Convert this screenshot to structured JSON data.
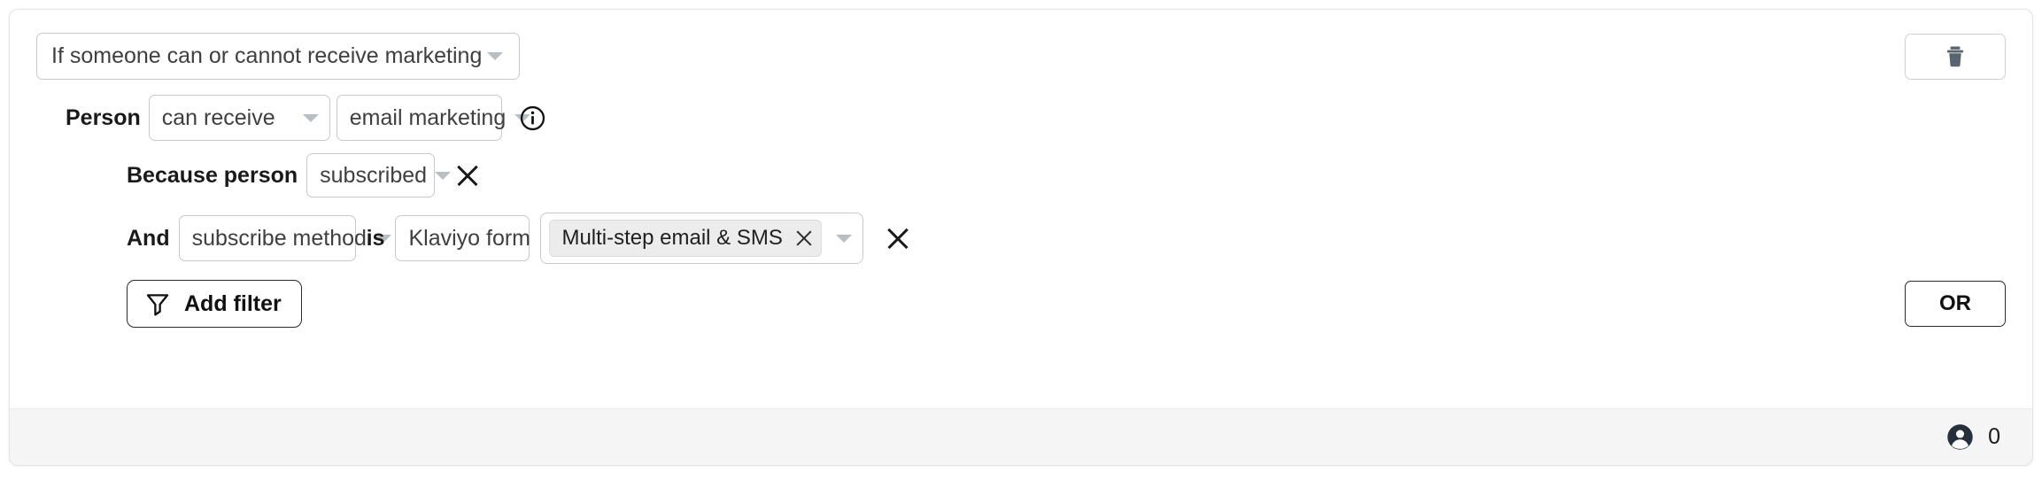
{
  "card": {
    "condition_select": {
      "value": "If someone can or cannot receive marketing",
      "caret_icon": "chevron-down-icon"
    },
    "delete_button": {
      "icon": "trash-icon",
      "label": ""
    },
    "person_row": {
      "label": "Person",
      "operator_select": {
        "value": "can receive",
        "caret_icon": "chevron-down-icon"
      },
      "channel_select": {
        "value": "email marketing",
        "caret_icon": "chevron-down-icon"
      },
      "info_icon": "info-circle-icon"
    },
    "because_row": {
      "label": "Because person",
      "reason_select": {
        "value": "subscribed",
        "caret_icon": "chevron-down-icon"
      },
      "remove_icon": "close-x-icon"
    },
    "and_row": {
      "label": "And",
      "attribute_select": {
        "value": "subscribe method",
        "caret_icon": "chevron-down-icon"
      },
      "comparator_label": "is",
      "source_select": {
        "value": "Klaviyo form",
        "caret_icon": "chevron-down-icon"
      },
      "value_multiselect": {
        "chips": [
          {
            "label": "Multi-step email & SMS",
            "remove_icon": "close-x-icon"
          }
        ],
        "caret_icon": "chevron-down-icon"
      },
      "remove_icon": "close-x-icon"
    },
    "bottom_row": {
      "add_filter_button": {
        "label": "Add filter",
        "icon": "funnel-icon"
      },
      "or_button": {
        "label": "OR"
      }
    },
    "footer": {
      "count_icon": "person-circle-icon",
      "count": "0"
    }
  },
  "colors": {
    "card_border": "#e3e3e3",
    "footer_bg": "#f5f5f5",
    "control_border": "#c9c9c9",
    "chip_bg": "#ececec",
    "text_primary": "#1a1a1a",
    "text_secondary": "#3f3f3f",
    "caret": "#b9bec3"
  }
}
